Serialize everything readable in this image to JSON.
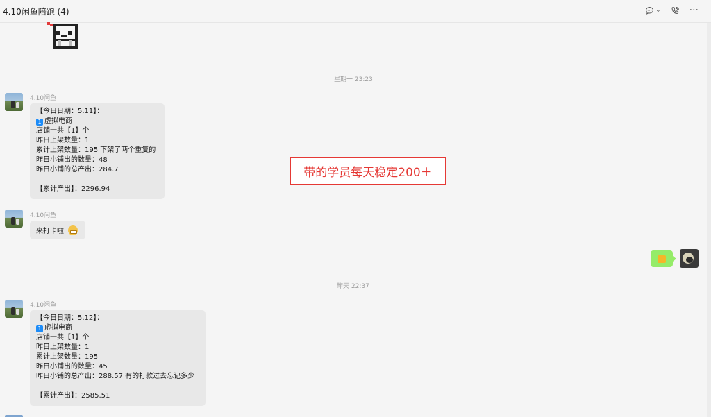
{
  "window": {
    "title": "4.10闲鱼陪跑 (4)"
  },
  "timestamps": {
    "first": "星期一 23:23",
    "second": "昨天 22:37"
  },
  "overlay_text": "带的学员每天稳定200＋",
  "messages": [
    {
      "sender": "4.10闲鱼",
      "lines": [
        "【今日日期：5.11】：",
        "虚拟电商",
        "店铺一共【1】个",
        "昨日上架数量：1",
        "累计上架数量：195 下架了两个重复的",
        "昨日小铺出的数量：48",
        "昨日小铺的总产出：284.7",
        "【累计产出】：2296.94"
      ],
      "badge": "1"
    },
    {
      "sender": "4.10闲鱼",
      "text": "来打卡啦",
      "emoji": "grin-emoji"
    },
    {
      "sender": "4.10闲鱼",
      "lines": [
        "【今日日期：5.12】：",
        "虚拟电商",
        "店铺一共【1】个",
        "昨日上架数量：1",
        "累计上架数量：195",
        "昨日小铺出的数量：45",
        "昨日小铺的总产出：288.57  有的打款过去忘记多少",
        "【累计产出】：2585.51"
      ],
      "badge": "1"
    }
  ],
  "my_message": {
    "emoji": "thumbs-up-emoji"
  },
  "colors": {
    "bubble_other": "#e8e8e8",
    "bubble_self": "#95ec69",
    "accent_red": "#e53935"
  },
  "icons": [
    "chat-icon",
    "chevron-down-icon",
    "phone-icon",
    "more-icon"
  ]
}
